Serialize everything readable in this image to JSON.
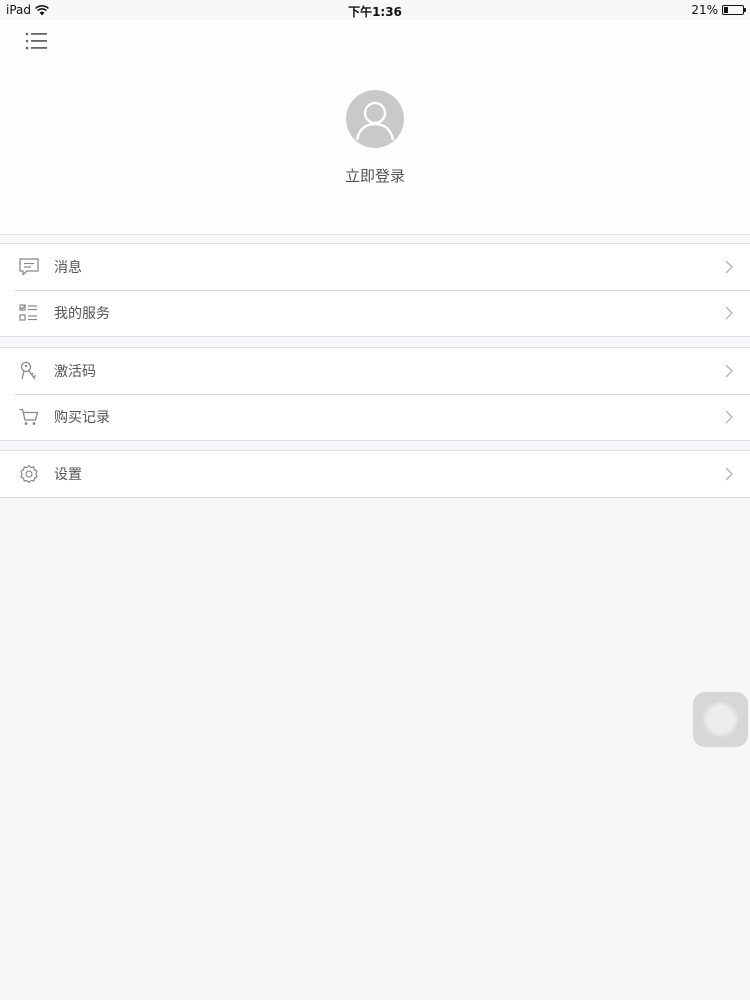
{
  "status_bar": {
    "device": "iPad",
    "time": "下午1:36",
    "battery": "21%",
    "battery_level": 0.21
  },
  "header": {
    "menu_icon": "list-menu-icon",
    "avatar_icon": "user-avatar-icon",
    "login_label": "立即登录"
  },
  "groups": [
    {
      "items": [
        {
          "icon": "message-icon",
          "label": "消息"
        },
        {
          "icon": "service-list-icon",
          "label": "我的服务"
        }
      ]
    },
    {
      "items": [
        {
          "icon": "key-icon",
          "label": "激活码"
        },
        {
          "icon": "cart-icon",
          "label": "购买记录"
        }
      ]
    },
    {
      "items": [
        {
          "icon": "gear-icon",
          "label": "设置"
        }
      ]
    }
  ],
  "colors": {
    "background": "#f7f6f9",
    "row_background": "#ffffff",
    "divider": "#dcdce0",
    "icon_gray": "#888888"
  }
}
